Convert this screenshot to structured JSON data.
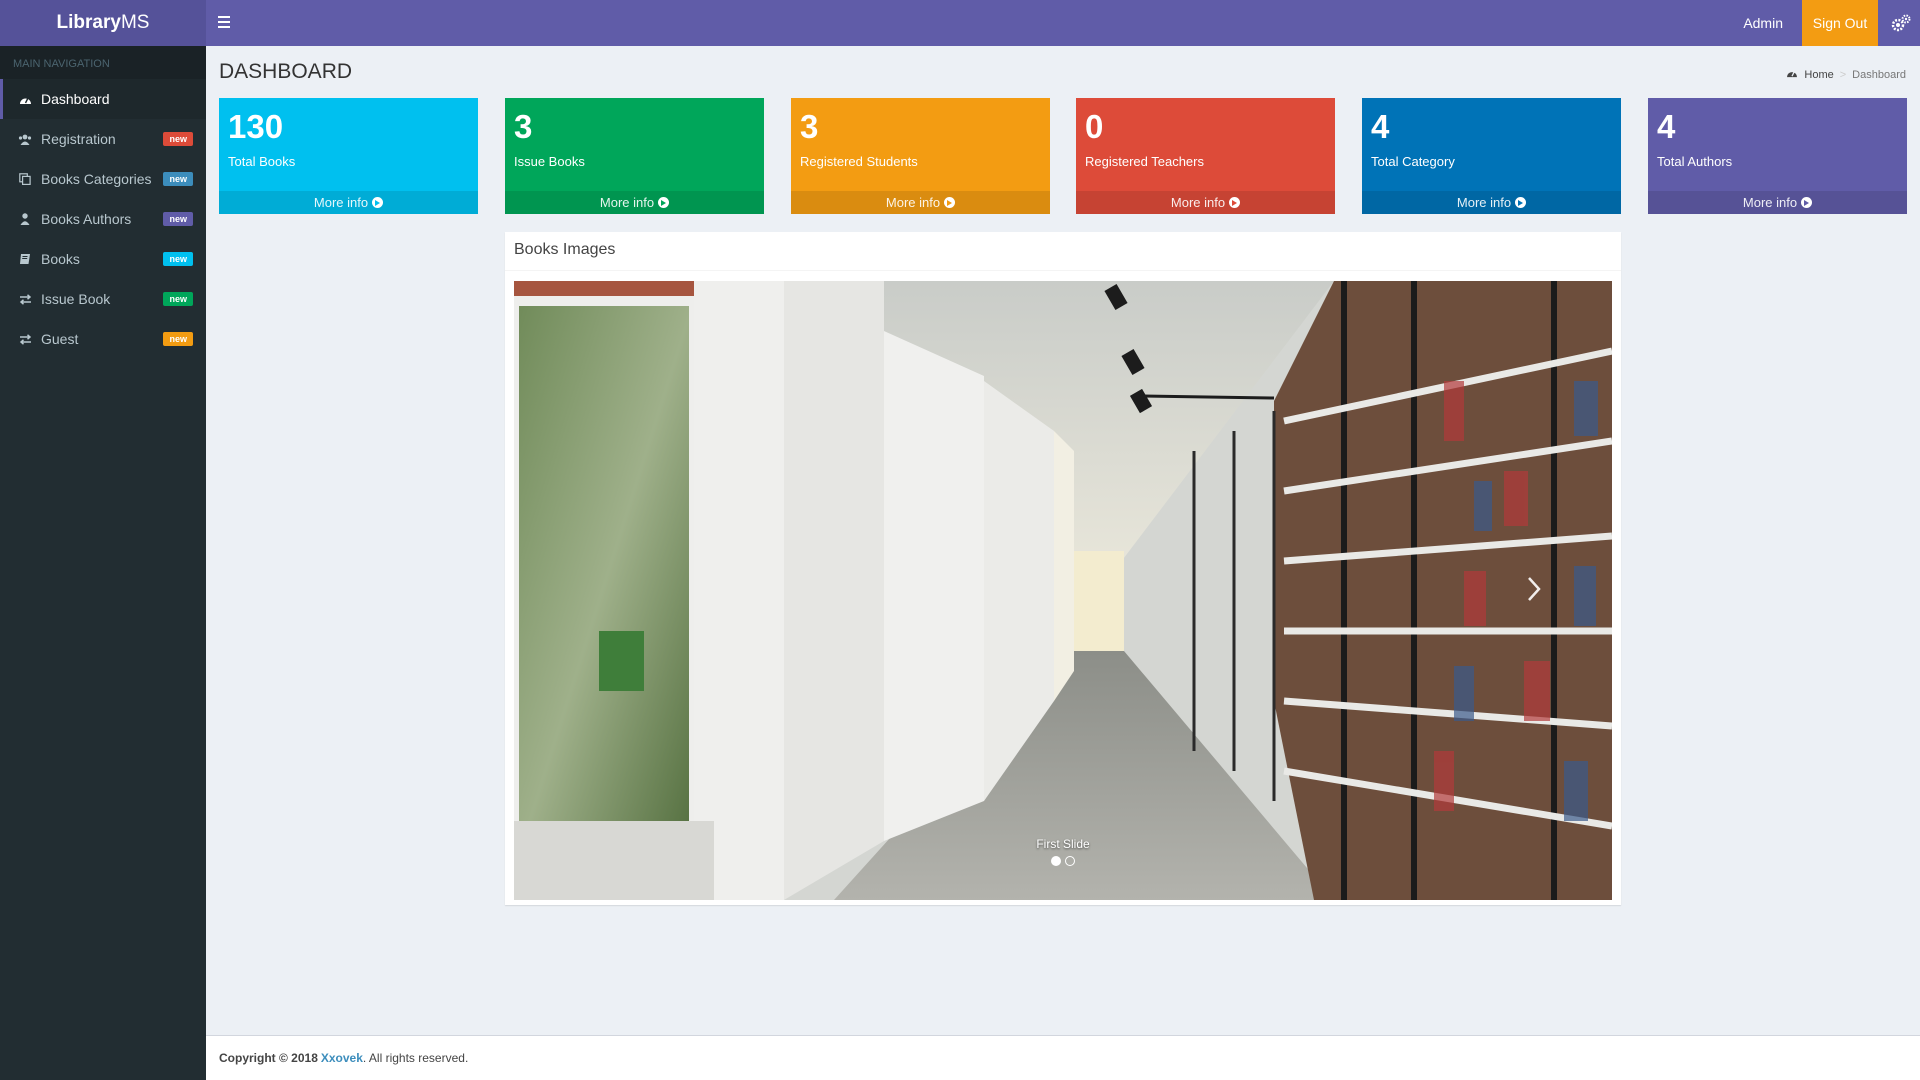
{
  "app": {
    "logo_bold": "Library",
    "logo_light": "MS"
  },
  "navbar": {
    "user": "Admin",
    "signout": "Sign Out"
  },
  "sidebar": {
    "header": "MAIN NAVIGATION",
    "items": [
      {
        "label": "Dashboard",
        "icon": "dashboard-icon",
        "badge": "",
        "badge_color": ""
      },
      {
        "label": "Registration",
        "icon": "users-icon",
        "badge": "new",
        "badge_color": "#dd4b39"
      },
      {
        "label": "Books Categories",
        "icon": "copy-icon",
        "badge": "new",
        "badge_color": "#3c8dbc"
      },
      {
        "label": "Books Authors",
        "icon": "user-icon",
        "badge": "new",
        "badge_color": "#605ca8"
      },
      {
        "label": "Books",
        "icon": "book-icon",
        "badge": "new",
        "badge_color": "#00c0ef"
      },
      {
        "label": "Issue Book",
        "icon": "exchange-icon",
        "badge": "new",
        "badge_color": "#00a65a"
      },
      {
        "label": "Guest",
        "icon": "exchange-icon",
        "badge": "new",
        "badge_color": "#f39c12"
      }
    ]
  },
  "page": {
    "title": "DASHBOARD"
  },
  "breadcrumb": {
    "home": "Home",
    "current": "Dashboard"
  },
  "stats": [
    {
      "value": "130",
      "label": "Total Books",
      "more": "More info",
      "color": "#00c0ef"
    },
    {
      "value": "3",
      "label": "Issue Books",
      "more": "More info",
      "color": "#00a65a"
    },
    {
      "value": "3",
      "label": "Registered Students",
      "more": "More info",
      "color": "#f39c12"
    },
    {
      "value": "0",
      "label": "Registered Teachers",
      "more": "More info",
      "color": "#dd4b39"
    },
    {
      "value": "4",
      "label": "Total Category",
      "more": "More info",
      "color": "#0073b7"
    },
    {
      "value": "4",
      "label": "Total Authors",
      "more": "More info",
      "color": "#605ca8"
    }
  ],
  "panel": {
    "title": "Books Images",
    "caption": "First Slide",
    "slides": 2,
    "active_slide": 1
  },
  "footer": {
    "copyright": "Copyright © 2018",
    "company": "Xxovek",
    "rest": ". All rights reserved."
  }
}
